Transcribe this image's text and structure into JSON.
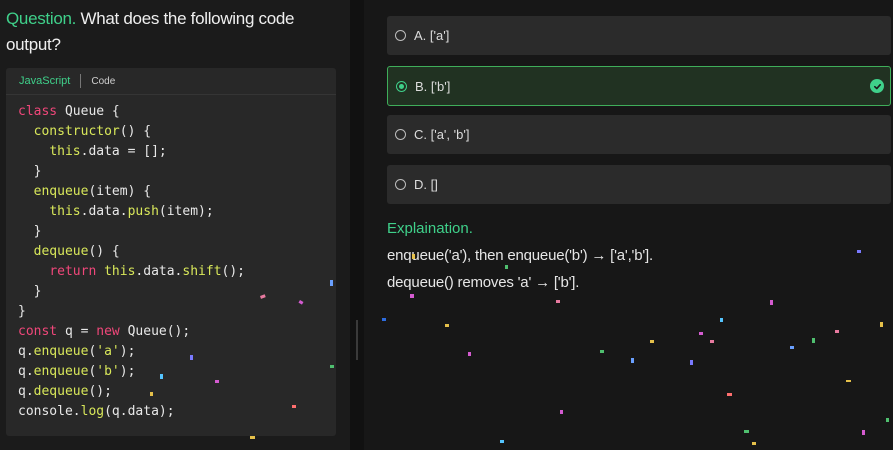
{
  "question": {
    "label": "Question.",
    "text": " What does the following code output?"
  },
  "code_card": {
    "language_tab": "JavaScript",
    "code_tab": "Code"
  },
  "options": [
    {
      "text": "A. ['a']",
      "selected": false
    },
    {
      "text": "B. ['b']",
      "selected": true
    },
    {
      "text": "C. ['a', 'b']",
      "selected": false
    },
    {
      "text": "D. []",
      "selected": false
    }
  ],
  "explanation": {
    "title": "Explaination.",
    "line1": "enqueue('a'), then enqueue('b') → ['a','b'].",
    "line2": "dequeue() removes 'a' → ['b']."
  },
  "colors": {
    "accent_green": "#3fd08a",
    "keyword_pink": "#f0477a",
    "function_yellow": "#d9e85a"
  }
}
